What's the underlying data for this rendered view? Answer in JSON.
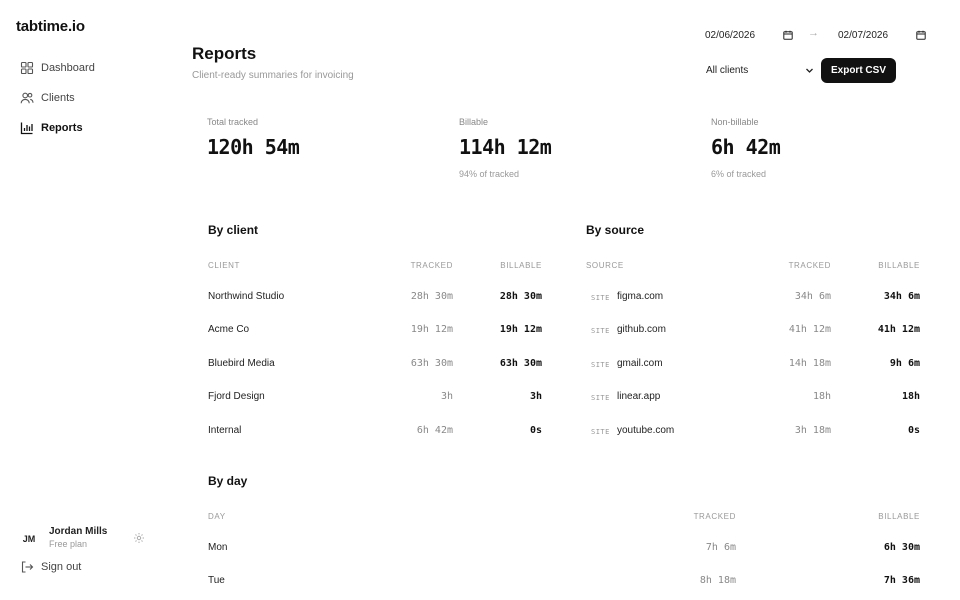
{
  "app": {
    "logo": "tabtime.io"
  },
  "sidebar": {
    "nav": [
      {
        "label": "Dashboard",
        "icon": "grid-icon"
      },
      {
        "label": "Clients",
        "icon": "users-icon"
      },
      {
        "label": "Reports",
        "icon": "bar-chart-icon",
        "active": true
      }
    ],
    "user": {
      "initials": "JM",
      "name": "Jordan Mills",
      "plan": "Free plan"
    },
    "signout_label": "Sign out"
  },
  "header": {
    "title": "Reports",
    "subtitle": "Client-ready summaries for invoicing",
    "date_from": "02/06/2026",
    "date_to": "02/07/2026",
    "arrow": "→",
    "client_filter": "All clients",
    "export_label": "Export CSV"
  },
  "stats": {
    "total": {
      "label": "Total tracked",
      "value": "120h 54m"
    },
    "billable": {
      "label": "Billable",
      "value": "114h 12m",
      "note": "94% of tracked"
    },
    "non_billable": {
      "label": "Non-billable",
      "value": "6h 42m",
      "note": "6% of tracked"
    }
  },
  "by_client": {
    "title": "By client",
    "headers": {
      "client": "CLIENT",
      "tracked": "TRACKED",
      "billable": "BILLABLE"
    },
    "rows": [
      {
        "client": "Northwind Studio",
        "tracked": "28h 30m",
        "billable": "28h 30m"
      },
      {
        "client": "Acme Co",
        "tracked": "19h 12m",
        "billable": "19h 12m"
      },
      {
        "client": "Bluebird Media",
        "tracked": "63h 30m",
        "billable": "63h 30m"
      },
      {
        "client": "Fjord Design",
        "tracked": "3h",
        "billable": "3h"
      },
      {
        "client": "Internal",
        "tracked": "6h 42m",
        "billable": "0s"
      }
    ]
  },
  "by_source": {
    "title": "By source",
    "headers": {
      "source": "SOURCE",
      "tracked": "TRACKED",
      "billable": "BILLABLE"
    },
    "rows": [
      {
        "tag": "SITE",
        "source": "figma.com",
        "tracked": "34h 6m",
        "billable": "34h 6m"
      },
      {
        "tag": "SITE",
        "source": "github.com",
        "tracked": "41h 12m",
        "billable": "41h 12m"
      },
      {
        "tag": "SITE",
        "source": "gmail.com",
        "tracked": "14h 18m",
        "billable": "9h 6m"
      },
      {
        "tag": "SITE",
        "source": "linear.app",
        "tracked": "18h",
        "billable": "18h"
      },
      {
        "tag": "SITE",
        "source": "youtube.com",
        "tracked": "3h 18m",
        "billable": "0s"
      }
    ]
  },
  "by_day": {
    "title": "By day",
    "headers": {
      "day": "DAY",
      "tracked": "TRACKED",
      "billable": "BILLABLE"
    },
    "rows": [
      {
        "day": "Mon",
        "tracked": "7h 6m",
        "billable": "6h 30m"
      },
      {
        "day": "Tue",
        "tracked": "8h 18m",
        "billable": "7h 36m"
      }
    ]
  },
  "colors": {
    "accent": "#111111",
    "muted": "#999999",
    "text": "#222222"
  }
}
